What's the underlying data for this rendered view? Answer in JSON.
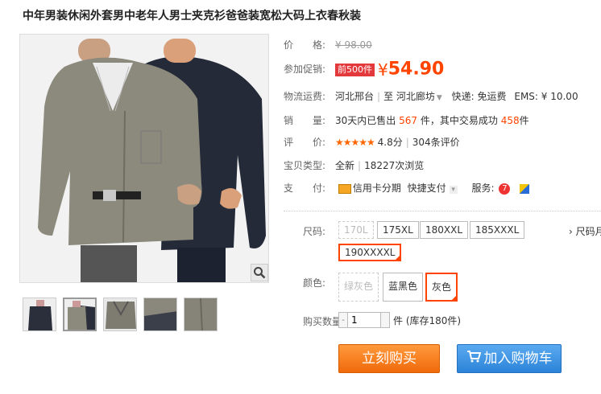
{
  "title": "中年男装休闲外套男中老年人男士夹克衫爸爸装宽松大码上衣春秋装",
  "price": {
    "label": "价　　格:",
    "original": "¥ 98.00"
  },
  "promo": {
    "label": "参加促销:",
    "tag": "前500件",
    "currency": "¥",
    "value": "54.90"
  },
  "shipping": {
    "label": "物流运费:",
    "from": "河北邢台",
    "sep": "|",
    "to_prefix": "至",
    "to": "河北廊坊",
    "express": "快递: 免运费",
    "ems": "EMS: ¥ 10.00"
  },
  "sales": {
    "label": "销　　量:",
    "prefix": "30天内已售出",
    "sold": "567",
    "middle": "件，其中交易成功",
    "success": "458",
    "suffix": "件"
  },
  "rating": {
    "label": "评　　价:",
    "stars": "★★★★★",
    "score": "4.8分",
    "sep": "|",
    "reviews": "304条评价"
  },
  "condition": {
    "label": "宝贝类型:",
    "type": "全新",
    "sep": "|",
    "views": "18227次浏览"
  },
  "payment": {
    "label": "支　　付:",
    "credit": "信用卡分期",
    "quick": "快捷支付",
    "service_label": "服务:"
  },
  "size": {
    "label": "尺码:",
    "options": [
      "170L",
      "175XL",
      "180XXL",
      "185XXXL",
      "190XXXXL"
    ],
    "more": "› 尺码月"
  },
  "color": {
    "label": "颜色:",
    "options": [
      "绿灰色",
      "蓝黑色",
      "灰色"
    ]
  },
  "quantity": {
    "label": "购买数量:",
    "minus": "-",
    "value": "1",
    "unit_stock": "件 (库存180件)"
  },
  "actions": {
    "buy": "立刻购买",
    "cart": "加入购物车"
  },
  "colors": {
    "accent": "#ff4400",
    "buy": "#f27b1c",
    "cart": "#3a8ee0"
  }
}
